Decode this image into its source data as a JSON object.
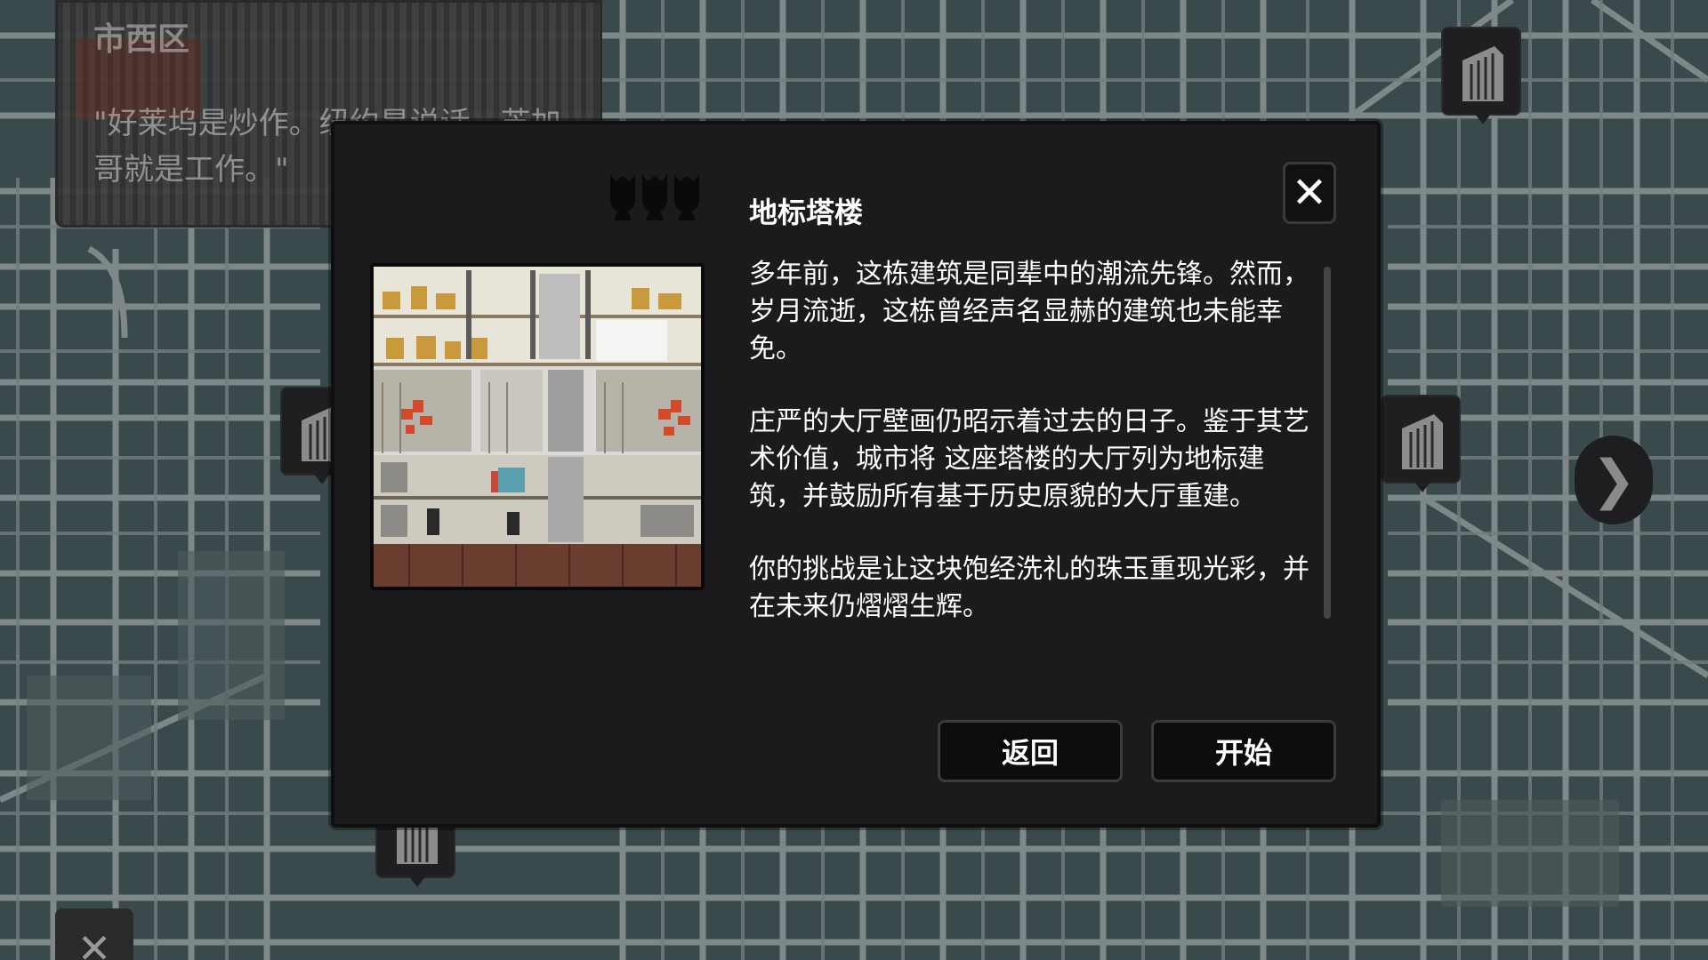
{
  "district": {
    "name": "市西区",
    "quote": "\"好莱坞是炒作。纽约是说话。芝加哥就是工作。\""
  },
  "modal": {
    "title": "地标塔楼",
    "difficulty_icon": "pawn-icon",
    "difficulty_level": 3,
    "description": [
      "多年前，这栋建筑是同辈中的潮流先锋。然而，岁月流逝，这栋曾经声名显赫的建筑也未能幸免。",
      "庄严的大厅壁画仍昭示着过去的日子。鉴于其艺术价值，城市将 这座塔楼的大厅列为地标建筑，并鼓励所有基于历史原貌的大厅重建。",
      "你的挑战是让这块饱经洗礼的珠玉重现光彩，并在未来仍熠熠生辉。"
    ],
    "close_label": "✕",
    "back_label": "返回",
    "start_label": "开始"
  },
  "map": {
    "next_label": "❯",
    "close_label": "✕"
  },
  "colors": {
    "map_bg": "#3b4a4d",
    "map_streets": "#8e9596",
    "modal_bg": "#1b1b1d",
    "button_bg": "#0d0d0f"
  }
}
